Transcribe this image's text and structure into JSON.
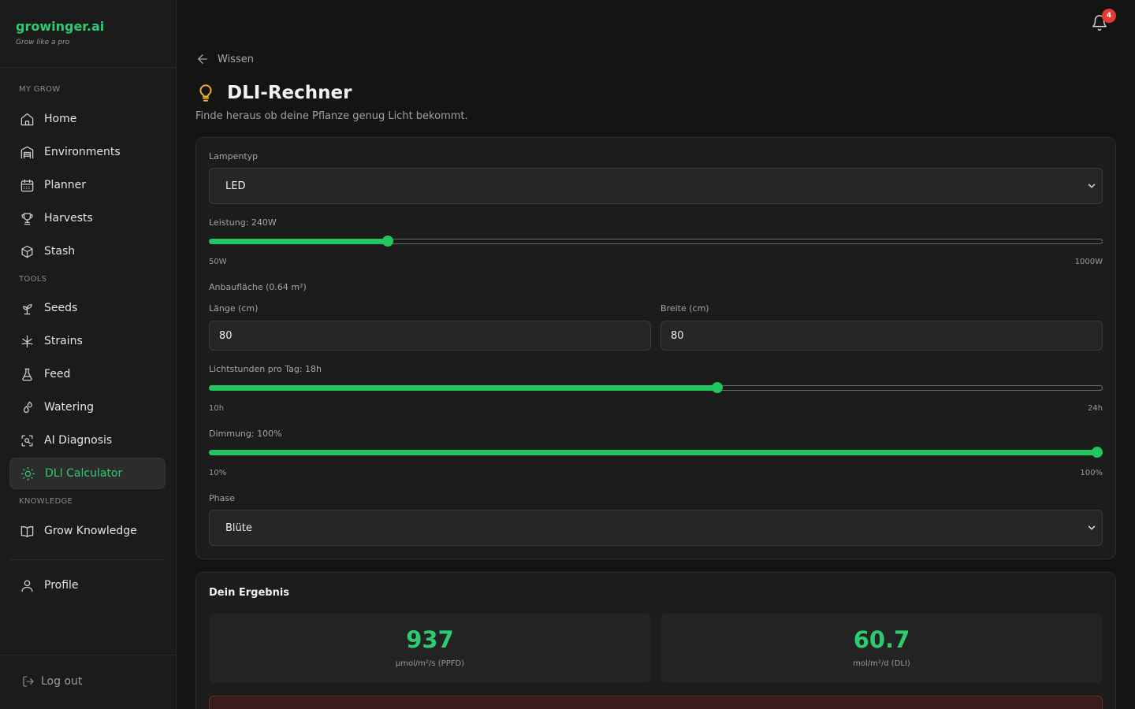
{
  "brand": {
    "name": "growinger.ai",
    "tagline": "Grow like a pro"
  },
  "sidebar": {
    "sections": {
      "my_grow": "MY GROW",
      "tools": "TOOLS",
      "knowledge": "KNOWLEDGE"
    },
    "items": [
      {
        "label": "Home",
        "icon": "home-icon"
      },
      {
        "label": "Environments",
        "icon": "warehouse-icon"
      },
      {
        "label": "Planner",
        "icon": "calendar-icon"
      },
      {
        "label": "Harvests",
        "icon": "trophy-icon"
      },
      {
        "label": "Stash",
        "icon": "box-icon"
      },
      {
        "label": "Seeds",
        "icon": "sprout-icon"
      },
      {
        "label": "Strains",
        "icon": "leaf-icon"
      },
      {
        "label": "Feed",
        "icon": "flask-icon"
      },
      {
        "label": "Watering",
        "icon": "droplets-icon"
      },
      {
        "label": "AI Diagnosis",
        "icon": "scan-icon"
      },
      {
        "label": "DLI Calculator",
        "icon": "sun-icon",
        "active": true
      },
      {
        "label": "Grow Knowledge",
        "icon": "book-icon"
      },
      {
        "label": "Profile",
        "icon": "user-icon"
      }
    ],
    "logout": "Log out"
  },
  "header": {
    "notification_count": "4"
  },
  "breadcrumb": {
    "back_label": "Wissen"
  },
  "page": {
    "title": "DLI-Rechner",
    "subtitle": "Finde heraus ob deine Pflanze genug Licht bekommt."
  },
  "form": {
    "lamp_type": {
      "label": "Lampentyp",
      "value": "LED"
    },
    "power": {
      "label": "Leistung: 240W",
      "min": "50W",
      "max": "1000W",
      "value": 240,
      "range": [
        50,
        1000
      ]
    },
    "area": {
      "label": "Anbaufläche (0.64 m²)"
    },
    "length": {
      "label": "Länge (cm)",
      "value": "80"
    },
    "width": {
      "label": "Breite (cm)",
      "value": "80"
    },
    "light_hours": {
      "label": "Lichtstunden pro Tag: 18h",
      "min": "10h",
      "max": "24h",
      "value": 18,
      "range": [
        10,
        24
      ]
    },
    "dimming": {
      "label": "Dimmung: 100%",
      "min": "10%",
      "max": "100%",
      "value": 100,
      "range": [
        10,
        100
      ]
    },
    "phase": {
      "label": "Phase",
      "value": "Blüte"
    }
  },
  "result": {
    "title": "Dein Ergebnis",
    "ppfd": {
      "value": "937",
      "unit": "µmol/m²/s (PPFD)"
    },
    "dli": {
      "value": "60.7",
      "unit": "mol/m²/d (DLI)"
    }
  },
  "colors": {
    "accent": "#22c55e",
    "warning": "#f0b429",
    "badge": "#e53935",
    "background": "#141414"
  }
}
